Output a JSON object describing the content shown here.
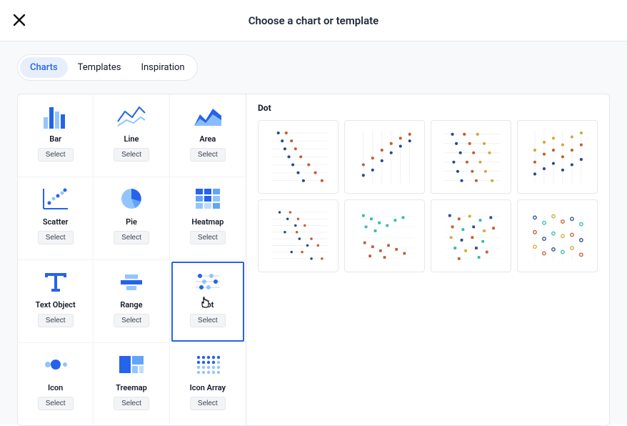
{
  "header": {
    "title": "Choose a chart or template"
  },
  "tabs": [
    {
      "label": "Charts",
      "active": true
    },
    {
      "label": "Templates",
      "active": false
    },
    {
      "label": "Inspiration",
      "active": false
    }
  ],
  "selectLabel": "Select",
  "chartTypes": [
    {
      "id": "bar",
      "label": "Bar",
      "selected": false
    },
    {
      "id": "line",
      "label": "Line",
      "selected": false
    },
    {
      "id": "area",
      "label": "Area",
      "selected": false
    },
    {
      "id": "scatter",
      "label": "Scatter",
      "selected": false
    },
    {
      "id": "pie",
      "label": "Pie",
      "selected": false
    },
    {
      "id": "heatmap",
      "label": "Heatmap",
      "selected": false
    },
    {
      "id": "textobject",
      "label": "Text Object",
      "selected": false
    },
    {
      "id": "range",
      "label": "Range",
      "selected": false
    },
    {
      "id": "dot",
      "label": "Dot",
      "selected": true
    },
    {
      "id": "icon",
      "label": "Icon",
      "selected": false
    },
    {
      "id": "treemap",
      "label": "Treemap",
      "selected": false
    },
    {
      "id": "iconarray",
      "label": "Icon Array",
      "selected": false
    }
  ],
  "preview": {
    "title": "Dot",
    "thumbnails": [
      "dot-template-1",
      "dot-template-2",
      "dot-template-3",
      "dot-template-4",
      "dot-template-5",
      "dot-template-6",
      "dot-template-7",
      "dot-template-8"
    ]
  },
  "colors": {
    "accent": "#2563eb",
    "accentLight": "#93c5fd",
    "orange": "#e88a3f",
    "gold": "#d4a93a",
    "teal": "#2ebfa5",
    "gray": "#d1d5db"
  }
}
